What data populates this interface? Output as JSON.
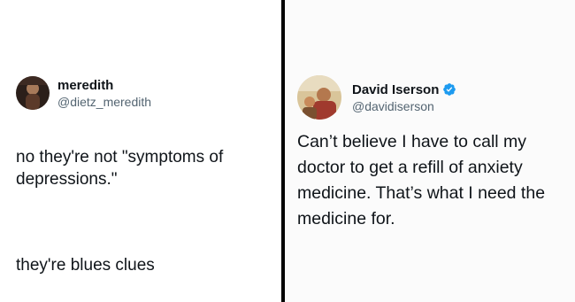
{
  "left_tweet": {
    "display_name": "meredith",
    "handle": "@dietz_meredith",
    "avatar_icon": "avatar-photo-icon",
    "text_line1": "no they're not \"symptoms of depressions.\"",
    "text_line2": "they're blues clues"
  },
  "right_tweet": {
    "display_name": "David Iserson",
    "handle": "@davidiserson",
    "verified_icon": "verified-badge-icon",
    "verified_color": "#1d9bf0",
    "avatar_icon": "avatar-photo-icon",
    "text": "Can’t believe I have to call my doctor to get a refill of anxiety medicine. That’s what I need the medicine for."
  },
  "colors": {
    "text_primary": "#0f1419",
    "text_secondary": "#536471",
    "divider": "#000000"
  }
}
